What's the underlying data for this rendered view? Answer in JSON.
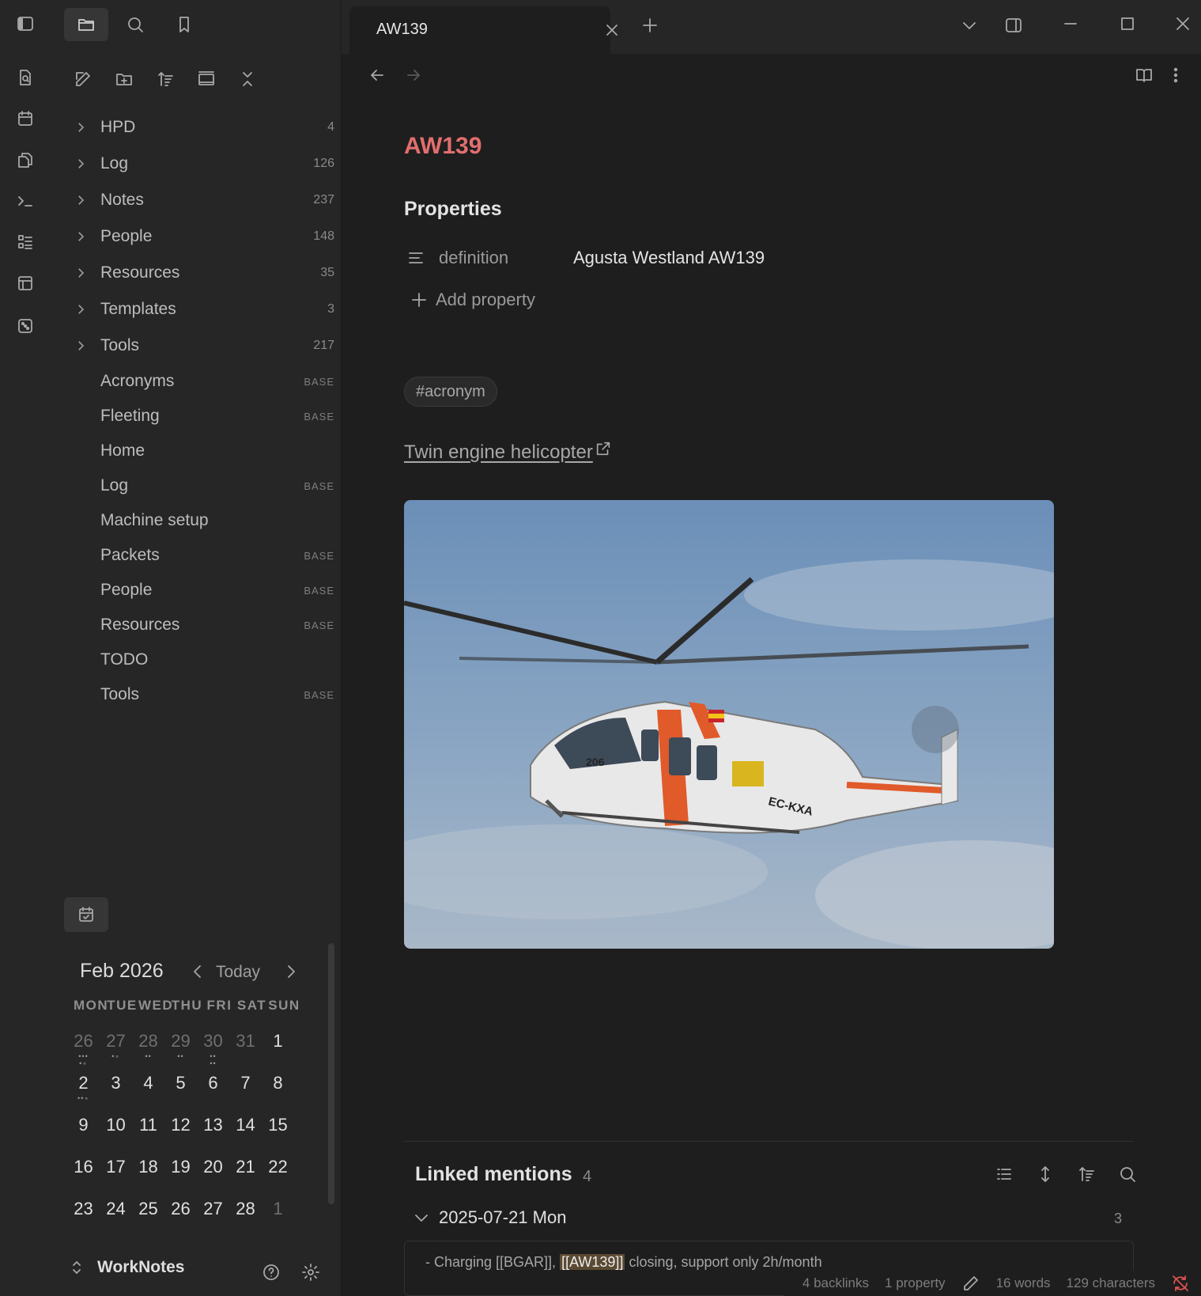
{
  "app": {
    "vault_name": "WorkNotes"
  },
  "ribbon": {
    "icons": [
      "sidebar-toggle-icon",
      "random-note-icon",
      "daily-note-icon",
      "templates-icon",
      "command-palette-icon",
      "outline-icon",
      "canvas-icon",
      "dice-icon"
    ]
  },
  "sidebar": {
    "tree": [
      {
        "type": "folder",
        "label": "HPD",
        "count": "4"
      },
      {
        "type": "folder",
        "label": "Log",
        "count": "126"
      },
      {
        "type": "folder",
        "label": "Notes",
        "count": "237"
      },
      {
        "type": "folder",
        "label": "People",
        "count": "148"
      },
      {
        "type": "folder",
        "label": "Resources",
        "count": "35"
      },
      {
        "type": "folder",
        "label": "Templates",
        "count": "3"
      },
      {
        "type": "folder",
        "label": "Tools",
        "count": "217"
      },
      {
        "type": "file",
        "label": "Acronyms",
        "tag": "BASE"
      },
      {
        "type": "file",
        "label": "Fleeting",
        "tag": "BASE"
      },
      {
        "type": "file",
        "label": "Home",
        "tag": ""
      },
      {
        "type": "file",
        "label": "Log",
        "tag": "BASE"
      },
      {
        "type": "file",
        "label": "Machine setup",
        "tag": ""
      },
      {
        "type": "file",
        "label": "Packets",
        "tag": "BASE"
      },
      {
        "type": "file",
        "label": "People",
        "tag": "BASE"
      },
      {
        "type": "file",
        "label": "Resources",
        "tag": "BASE"
      },
      {
        "type": "file",
        "label": "TODO",
        "tag": ""
      },
      {
        "type": "file",
        "label": "Tools",
        "tag": "BASE"
      }
    ]
  },
  "calendar": {
    "month": "Feb 2026",
    "today_label": "Today",
    "dows": [
      "MON",
      "TUE",
      "WED",
      "THU",
      "FRI",
      "SAT",
      "SUN"
    ],
    "weeks": [
      [
        {
          "d": "26",
          "dim": true,
          "dots": "•••\n•∘"
        },
        {
          "d": "27",
          "dim": true,
          "dots": "•∘"
        },
        {
          "d": "28",
          "dim": true,
          "dots": "••"
        },
        {
          "d": "29",
          "dim": true,
          "dots": "••"
        },
        {
          "d": "30",
          "dim": true,
          "dots": "••\n••"
        },
        {
          "d": "31",
          "dim": true,
          "dots": ""
        },
        {
          "d": "1",
          "dim": false,
          "dots": ""
        }
      ],
      [
        {
          "d": "2",
          "dim": false,
          "dots": "••∘"
        },
        {
          "d": "3",
          "dim": false,
          "dots": ""
        },
        {
          "d": "4",
          "dim": false,
          "dots": ""
        },
        {
          "d": "5",
          "dim": false,
          "dots": ""
        },
        {
          "d": "6",
          "dim": false,
          "dots": ""
        },
        {
          "d": "7",
          "dim": false,
          "dots": ""
        },
        {
          "d": "8",
          "dim": false,
          "dots": ""
        }
      ],
      [
        {
          "d": "9",
          "dim": false,
          "dots": ""
        },
        {
          "d": "10",
          "dim": false,
          "dots": ""
        },
        {
          "d": "11",
          "dim": false,
          "dots": ""
        },
        {
          "d": "12",
          "dim": false,
          "dots": ""
        },
        {
          "d": "13",
          "dim": false,
          "dots": ""
        },
        {
          "d": "14",
          "dim": false,
          "dots": ""
        },
        {
          "d": "15",
          "dim": false,
          "dots": ""
        }
      ],
      [
        {
          "d": "16",
          "dim": false,
          "dots": ""
        },
        {
          "d": "17",
          "dim": false,
          "dots": ""
        },
        {
          "d": "18",
          "dim": false,
          "dots": ""
        },
        {
          "d": "19",
          "dim": false,
          "dots": ""
        },
        {
          "d": "20",
          "dim": false,
          "dots": ""
        },
        {
          "d": "21",
          "dim": false,
          "dots": ""
        },
        {
          "d": "22",
          "dim": false,
          "dots": ""
        }
      ],
      [
        {
          "d": "23",
          "dim": false,
          "dots": ""
        },
        {
          "d": "24",
          "dim": false,
          "dots": ""
        },
        {
          "d": "25",
          "dim": false,
          "dots": ""
        },
        {
          "d": "26",
          "dim": false,
          "dots": ""
        },
        {
          "d": "27",
          "dim": false,
          "dots": ""
        },
        {
          "d": "28",
          "dim": false,
          "dots": ""
        },
        {
          "d": "1",
          "dim": true,
          "dots": ""
        }
      ]
    ]
  },
  "tab": {
    "title": "AW139"
  },
  "note": {
    "title": "AW139",
    "properties_heading": "Properties",
    "property": {
      "key": "definition",
      "value": "Agusta Westland AW139"
    },
    "add_property": "Add property",
    "tag": "#acronym",
    "link_text": "Twin engine helicopter"
  },
  "linked_mentions": {
    "title": "Linked mentions",
    "count": "4",
    "group_date": "2025-07-21 Mon",
    "group_count": "3",
    "snippet_before": "- Charging [[BGAR]], ",
    "snippet_highlight": "[[AW139]]",
    "snippet_after": " closing, support only 2h/month"
  },
  "status": {
    "backlinks": "4 backlinks",
    "properties": "1 property",
    "words": "16 words",
    "characters": "129 characters"
  },
  "colors": {
    "accent": "#e26e6e",
    "bg": "#1e1e1e",
    "sidebar_bg": "#262626",
    "sync_error": "#d9534f"
  }
}
